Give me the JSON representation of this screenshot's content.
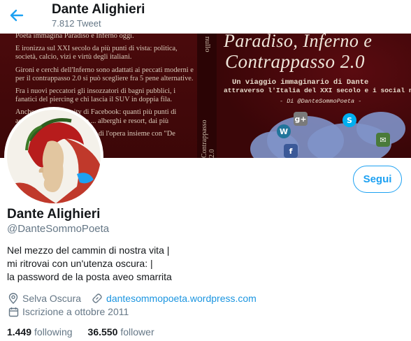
{
  "header": {
    "title": "Dante Alighieri",
    "tweet_count": "7.812 Tweet"
  },
  "banner": {
    "book_text": [
      "Poeta immagina Paradiso e Inferno oggi.",
      "E ironizza sul XXI secolo da più punti di vista: politica, società, calcio, vizi e virtù degli italiani.",
      "Gironi e cerchi dell'Inferno sono adattati ai peccati moderni e per il contrappasso 2.0 si può scegliere fra 5 pene alternative.",
      "Fra i nuovi peccatori gli insozzatori di bagni pubblici, i fanatici del piercing e chi lascia il SUV in doppia fila.",
      "Anche una community di Facebook: quanti più punti di accumulano per accedere ... alberghi e resort, dai più",
      "Le prose di Dante ma anche di l'opera insieme con \"De"
    ],
    "spine_top": "nullo",
    "spine_bottom": "Contrappasso 2.0",
    "cover_title_line1": "Paradiso, Inferno e",
    "cover_title_line2": "Contrappasso 2.0",
    "cover_subtitle_line1": "Un viaggio immaginario di Dante",
    "cover_subtitle_line2": "attraverso l'Italia del XXI secolo e i social network",
    "cover_author": "- Di @DanteSommoPoeta -",
    "social_icons": [
      {
        "name": "wordpress-icon",
        "glyph": "W",
        "color": "#21759b"
      },
      {
        "name": "googleplus-icon",
        "glyph": "g+",
        "color": "#7a7a7a"
      },
      {
        "name": "skype-icon",
        "glyph": "S",
        "color": "#00aff0"
      },
      {
        "name": "facebook-icon",
        "glyph": "f",
        "color": "#3b5998"
      },
      {
        "name": "email-icon",
        "glyph": "✉",
        "color": "#4a7a3a"
      }
    ]
  },
  "profile": {
    "name": "Dante Alighieri",
    "handle": "@DanteSommoPoeta",
    "follow_label": "Segui",
    "bio_lines": [
      "Nel mezzo del cammin di nostra vita |",
      "mi ritrovai con un'utenza oscura: |",
      "la password de la posta aveo smarrita"
    ],
    "location": "Selva Oscura",
    "website": "dantesommopoeta.wordpress.com",
    "joined": "Iscrizione a ottobre 2011",
    "following_count": "1.449",
    "following_label": "following",
    "followers_count": "36.550",
    "followers_label": "follower"
  },
  "colors": {
    "accent": "#1da1f2",
    "link": "#1b95e0",
    "secondary_text": "#657786",
    "banner_bg": "#3a0608"
  }
}
